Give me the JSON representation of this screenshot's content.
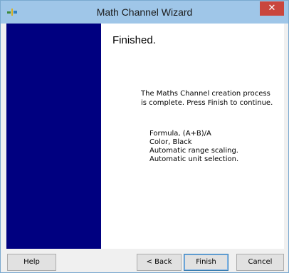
{
  "window": {
    "title": "Math Channel Wizard",
    "close_glyph": "✕",
    "icon": "app-icon"
  },
  "page": {
    "heading": "Finished.",
    "message": "The Maths Channel creation process is complete. Press Finish to continue.",
    "details": [
      "Formula, (A+B)/A",
      "Color, Black",
      "Automatic range scaling.",
      "Automatic unit selection."
    ]
  },
  "buttons": {
    "help": "Help",
    "back": "< Back",
    "finish": "Finish",
    "cancel": "Cancel"
  },
  "colors": {
    "titlebar": "#9fc6e8",
    "side_panel": "#000080",
    "close_button": "#c9463d"
  }
}
